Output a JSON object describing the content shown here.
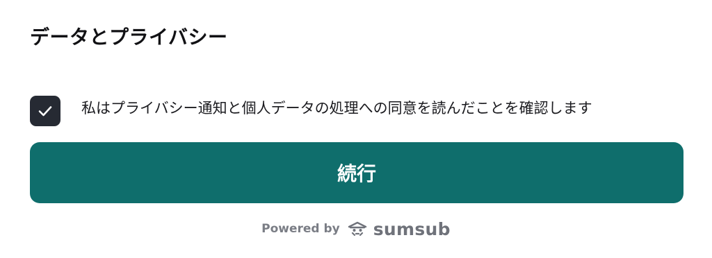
{
  "header": {
    "title": "データとプライバシー"
  },
  "consent": {
    "checked": true,
    "label": "私はプライバシー通知と個人データの処理への同意を読んだことを確認します"
  },
  "actions": {
    "continue_label": "続行"
  },
  "footer": {
    "powered_by": "Powered by",
    "brand": "sumsub",
    "logo_icon": "sumsub-logo-icon"
  },
  "colors": {
    "primary": "#0f6e6c",
    "checkbox": "#262a33",
    "text": "#1b1b1f",
    "muted": "#7a7d85"
  }
}
